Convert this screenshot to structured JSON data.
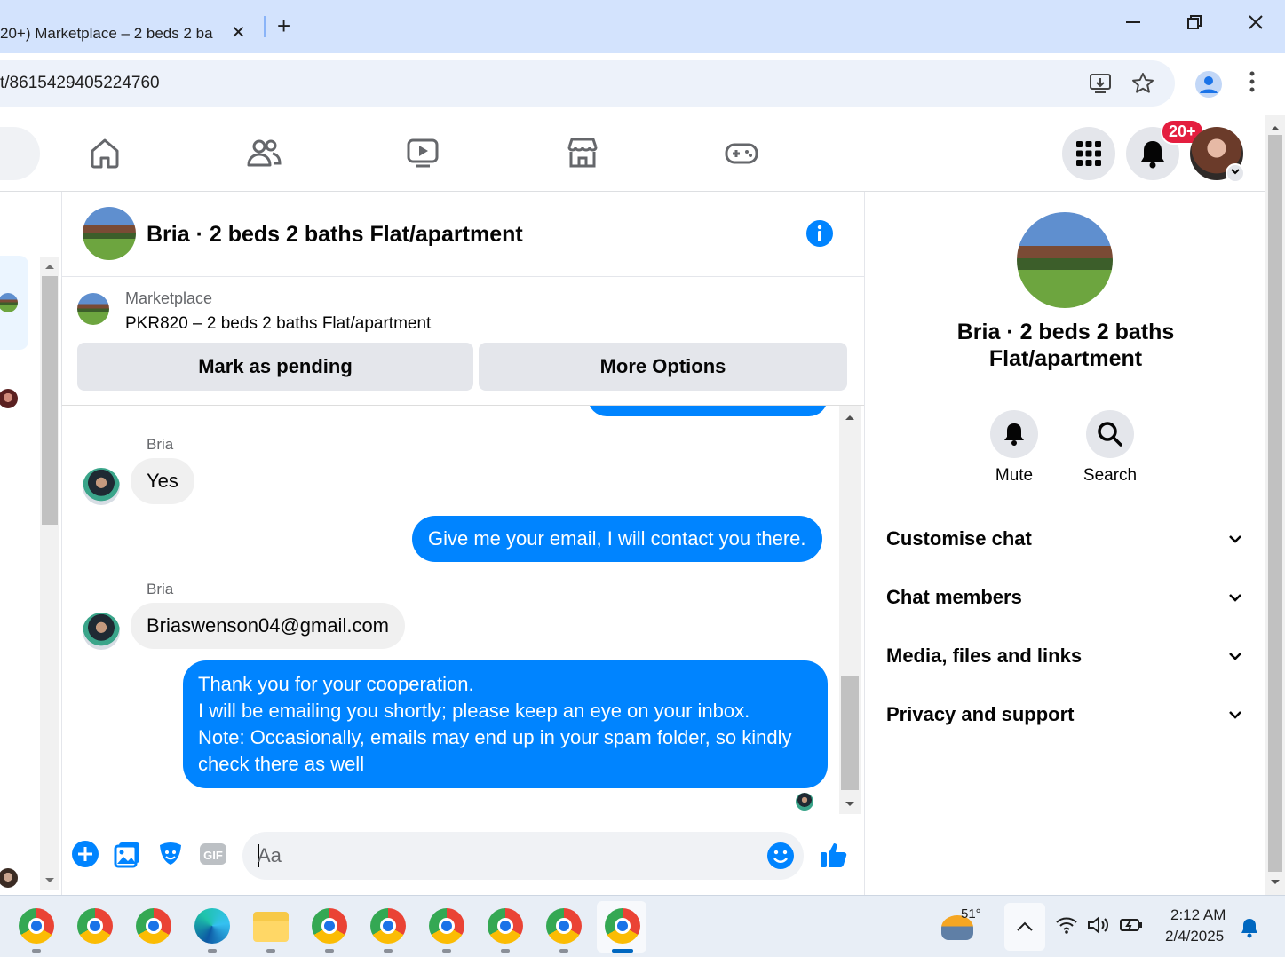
{
  "browser": {
    "tab_title": "20+) Marketplace – 2 beds 2 ba",
    "tab_close": "✕",
    "new_tab": "+",
    "url": "t/8615429405224760",
    "window_minimize": "—",
    "window_restore": "❐",
    "window_close": "✕"
  },
  "fb_nav": {
    "notifications_badge": "20+"
  },
  "chat": {
    "title": "Bria · 2 beds 2 baths Flat/apartment",
    "marketplace_label": "Marketplace",
    "listing": "PKR820 – 2 beds 2 baths Flat/apartment",
    "mark_pending": "Mark as pending",
    "more_options": "More Options",
    "messages": [
      {
        "from": "Bria",
        "text": "Yes"
      },
      {
        "from": "me",
        "text": "Give me your email, I will contact you there."
      },
      {
        "from": "Bria",
        "text": "Briaswenson04@gmail.com"
      },
      {
        "from": "me",
        "lines": [
          "Thank you for your cooperation.",
          "I will be emailing you shortly; please keep an eye on your inbox.",
          "Note: Occasionally, emails may end up in your spam folder, so kindly",
          "check there as well"
        ]
      }
    ],
    "composer_placeholder": "Aa"
  },
  "right_panel": {
    "title_line1": "Bria · 2 beds 2 baths",
    "title_line2": "Flat/apartment",
    "mute": "Mute",
    "search": "Search",
    "sections": [
      "Customise chat",
      "Chat members",
      "Media, files and links",
      "Privacy and support"
    ]
  },
  "taskbar": {
    "weather": "51°",
    "time": "2:12 AM",
    "date": "2/4/2025"
  },
  "colors": {
    "messenger_blue": "#0084ff",
    "fb_blue": "#1877f2",
    "badge_red": "#e41e3f"
  }
}
